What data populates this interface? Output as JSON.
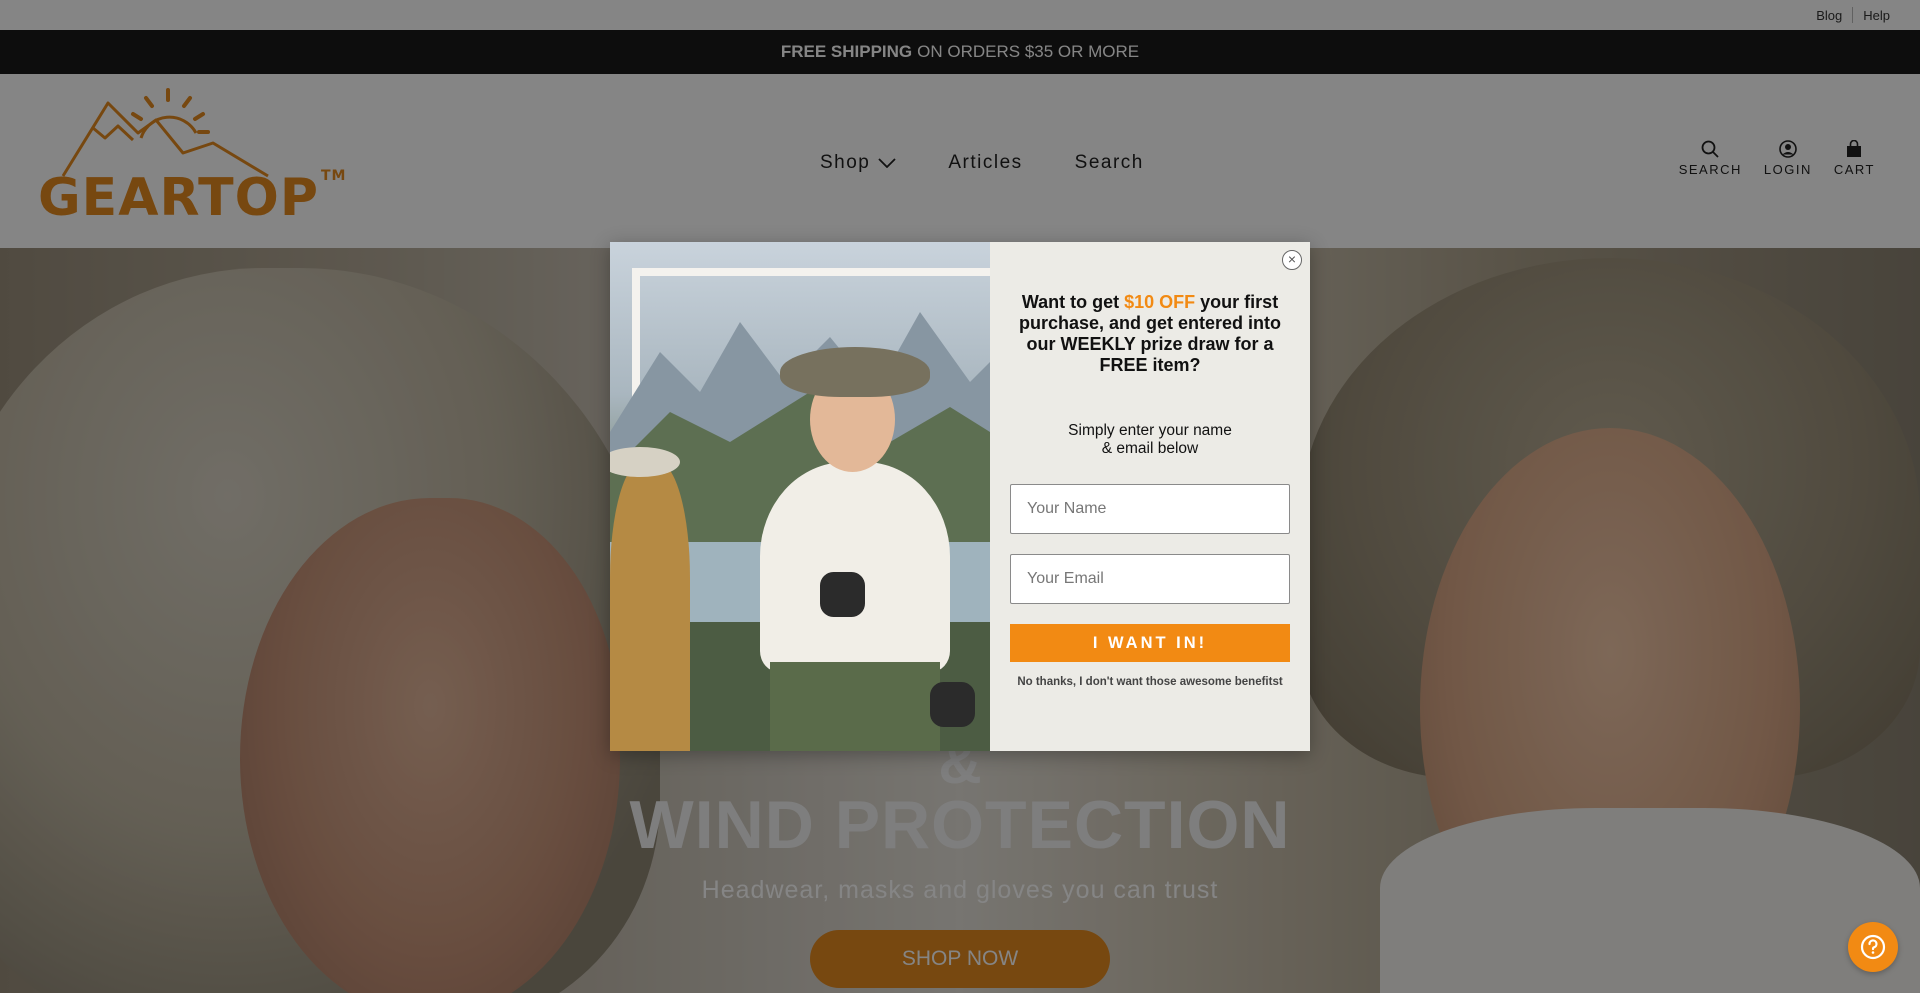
{
  "utility": {
    "blog": "Blog",
    "help": "Help"
  },
  "announcement": {
    "bold": "FREE SHIPPING",
    "rest": "ON ORDERS $35 OR MORE"
  },
  "logo": {
    "text": "GEARTOP",
    "tm": "TM"
  },
  "nav": {
    "shop": "Shop",
    "articles": "Articles",
    "search": "Search"
  },
  "header_icons": {
    "search": "SEARCH",
    "login": "LOGIN",
    "cart": "CART"
  },
  "hero": {
    "amp": "&",
    "title": "WIND PROTECTION",
    "subtitle": "Headwear, masks and gloves you can trust",
    "cta": "SHOP NOW"
  },
  "popup": {
    "headline_pre": "Want to get ",
    "headline_accent": "$10 OFF",
    "headline_post": " your first purchase, and get entered into our WEEKLY prize draw for a FREE item?",
    "sub_line1": "Simply enter your name",
    "sub_line2": "& email below",
    "name_placeholder": "Your Name",
    "email_placeholder": "Your Email",
    "submit": "I WANT IN!",
    "decline": "No thanks, I don't want those awesome benefitst",
    "close": "×"
  },
  "colors": {
    "accent": "#f28a13",
    "logo": "#e58a20",
    "announce_bg": "#1a1a1a"
  },
  "icons": [
    "search-icon",
    "user-icon",
    "bag-icon",
    "chevron-down-icon",
    "close-icon",
    "help-icon"
  ]
}
